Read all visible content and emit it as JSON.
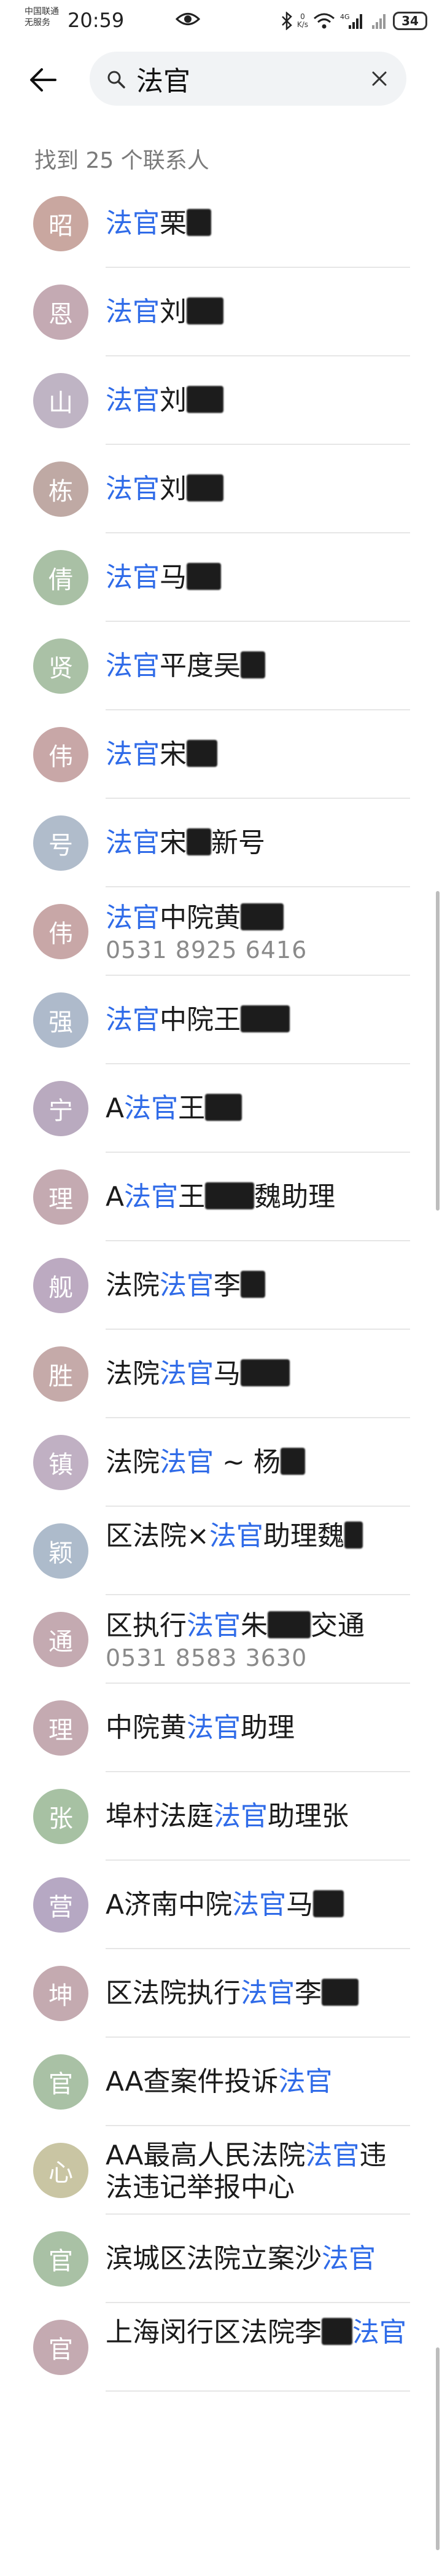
{
  "status": {
    "carrier_line1": "中国联通",
    "carrier_line2": "无服务",
    "time": "20:59",
    "netspeed_value": "0",
    "netspeed_unit": "K/s",
    "battery": "34"
  },
  "search": {
    "query": "法官"
  },
  "result_count": "找到 25 个联系人",
  "contacts": [
    {
      "avatar": "昭",
      "color": "#c9a7a0",
      "pre": "",
      "hl": "法官",
      "post": "栗",
      "redact": 40
    },
    {
      "avatar": "恩",
      "color": "#c4aab3",
      "pre": "",
      "hl": "法官",
      "post": "刘",
      "redact": 60
    },
    {
      "avatar": "山",
      "color": "#bfb4c4",
      "pre": "",
      "hl": "法官",
      "post": "刘",
      "redact": 60
    },
    {
      "avatar": "栋",
      "color": "#bfa9a4",
      "pre": "",
      "hl": "法官",
      "post": "刘",
      "redact": 60
    },
    {
      "avatar": "倩",
      "color": "#a9c0a5",
      "pre": "",
      "hl": "法官",
      "post": "马",
      "redact": 56
    },
    {
      "avatar": "贤",
      "color": "#aac1a6",
      "pre": "",
      "hl": "法官",
      "post": "平度吴",
      "redact": 40
    },
    {
      "avatar": "伟",
      "color": "#c8a7a7",
      "pre": "",
      "hl": "法官",
      "post": "宋",
      "redact": 50
    },
    {
      "avatar": "号",
      "color": "#b0bccb",
      "pre": "",
      "hl": "法官",
      "post": "宋",
      "post2": "新号",
      "redact": 40
    },
    {
      "avatar": "伟",
      "color": "#c8a7a7",
      "pre": "",
      "hl": "法官",
      "post": "中院黄",
      "redact": 70,
      "phone": "0531 8925 6416"
    },
    {
      "avatar": "强",
      "color": "#aebacb",
      "pre": "",
      "hl": "法官",
      "post": "中院王",
      "redact": 80
    },
    {
      "avatar": "宁",
      "color": "#b9aabf",
      "pre": "A",
      "hl": "法官",
      "post": "王",
      "redact": 60
    },
    {
      "avatar": "理",
      "color": "#c4aab1",
      "pre": "A",
      "hl": "法官",
      "post": "王",
      "post2": "魏助理",
      "redact": 80
    },
    {
      "avatar": "舰",
      "color": "#bcaac1",
      "pre": "法院",
      "hl": "法官",
      "post": "李",
      "redact": 40
    },
    {
      "avatar": "胜",
      "color": "#c5aaa9",
      "pre": "法院",
      "hl": "法官",
      "post": "马",
      "redact": 80
    },
    {
      "avatar": "镇",
      "color": "#c0b0c3",
      "pre": "法院",
      "hl": "法官",
      "post": " ~ 杨",
      "redact": 40
    },
    {
      "avatar": "颖",
      "color": "#adbbcb",
      "pre": "区法院×",
      "hl": "法官",
      "post": "助理魏",
      "redact": 30,
      "wrap": true
    },
    {
      "avatar": "通",
      "color": "#c4aab1",
      "pre": "区执行",
      "hl": "法官",
      "post": "朱",
      "post2": "交通",
      "redact": 70,
      "phone": "0531 8583 3630"
    },
    {
      "avatar": "理",
      "color": "#c4aab1",
      "pre": "中院黄",
      "hl": "法官",
      "post": "助理",
      "redact": 0
    },
    {
      "avatar": "张",
      "color": "#a7c1a3",
      "pre": "埠村法庭",
      "hl": "法官",
      "post": "助理张",
      "redact": 0
    },
    {
      "avatar": "营",
      "color": "#b6a8c3",
      "pre": "A济南中院",
      "hl": "法官",
      "post": "马",
      "redact": 50
    },
    {
      "avatar": "坤",
      "color": "#c4aab0",
      "pre": "区法院执行",
      "hl": "法官",
      "post": "李",
      "redact": 60
    },
    {
      "avatar": "官",
      "color": "#a9c1a5",
      "pre": "AA查案件投诉",
      "hl": "法官",
      "post": "",
      "redact": 0
    },
    {
      "avatar": "心",
      "color": "#c9c5a3",
      "pre": "AA最高人民法院",
      "hl": "法官",
      "post": "违法违记举报中心",
      "redact": 0,
      "wrap": true
    },
    {
      "avatar": "官",
      "color": "#a9c1a5",
      "pre": "滨城区法院立案沙",
      "hl": "法官",
      "post": "",
      "redact": 0
    },
    {
      "avatar": "官",
      "color": "#c4aab1",
      "pre": "上海闵行区法院李",
      "hl": "法官",
      "post": "",
      "redact": 50,
      "wrap": true,
      "redact_before_hl": true
    }
  ],
  "icons": {
    "back": "back-arrow-icon",
    "search": "search-icon",
    "clear": "close-icon",
    "eye": "eye-icon"
  }
}
